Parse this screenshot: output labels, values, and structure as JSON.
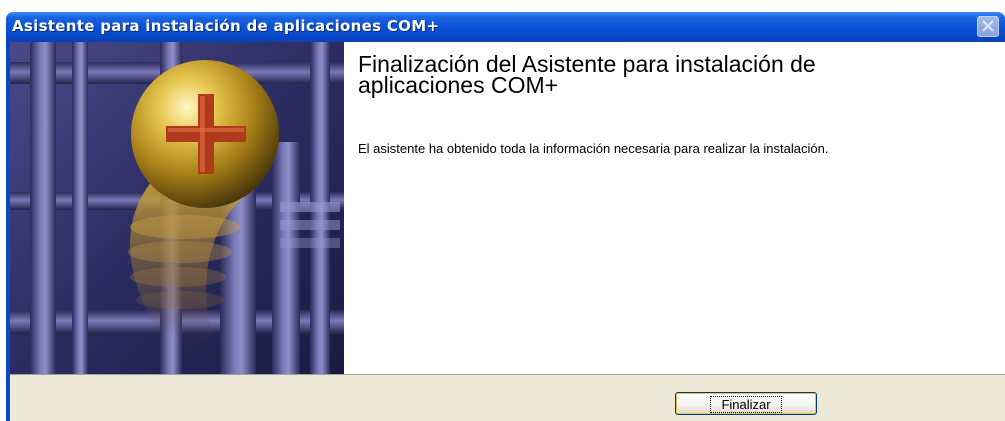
{
  "window": {
    "title": "Asistente para instalación de aplicaciones COM+"
  },
  "content": {
    "heading": "Finalización del Asistente para instalación de aplicaciones COM+",
    "body": "El asistente ha obtenido toda la información necesaria para realizar la instalación."
  },
  "footer": {
    "finish_label": "Finalizar"
  },
  "icons": {
    "close": "close-icon",
    "banner": "com-plus-logo"
  },
  "colors": {
    "titlebar": "#0a52d8",
    "footer": "#ece9d8",
    "button_border": "#003c74",
    "banner_purple": "#3a3a78",
    "logo_gold": "#c8a028"
  }
}
